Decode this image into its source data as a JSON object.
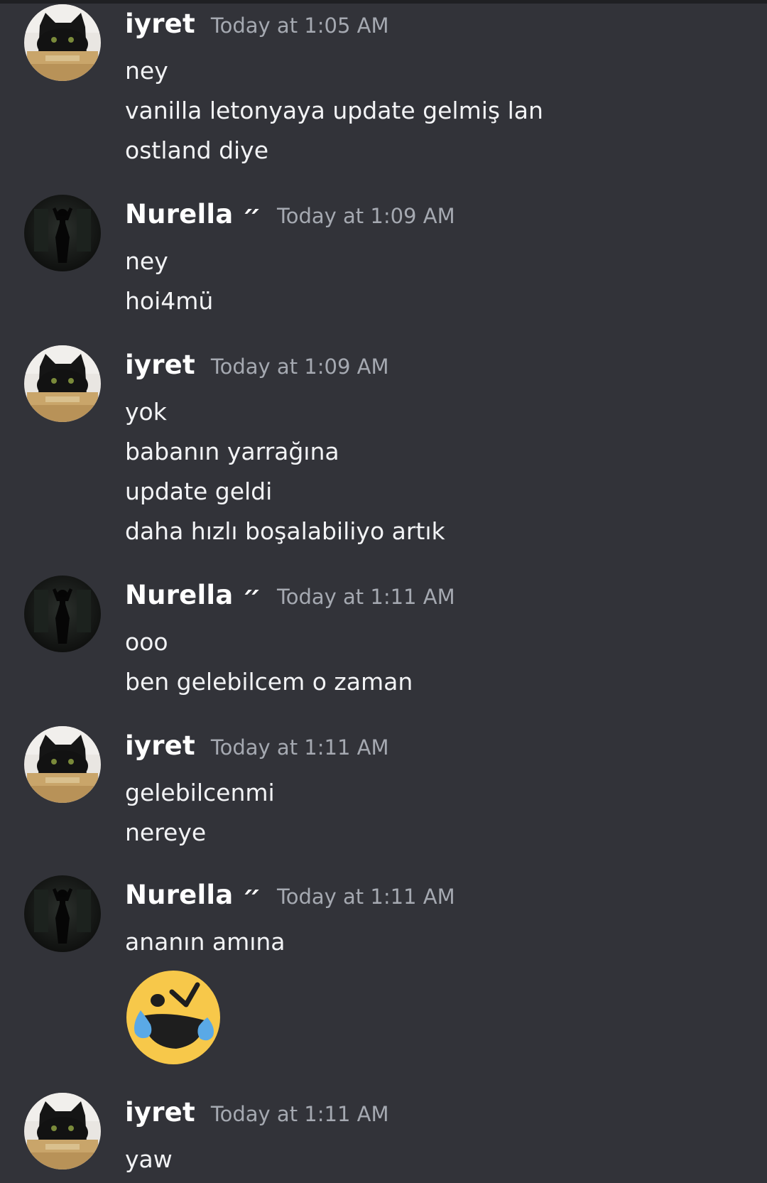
{
  "users": {
    "iyret": {
      "name": "iyret",
      "avatar": "cat-avatar"
    },
    "nurella": {
      "name": "Nurella ״",
      "avatar": "silhouette-avatar"
    }
  },
  "messages": [
    {
      "author": "iyret",
      "timestamp": "Today at 1:05 AM",
      "lines": [
        "ney",
        "vanilla letonyaya update gelmiş lan",
        "ostland diye"
      ]
    },
    {
      "author": "Nurella ״",
      "timestamp": "Today at 1:09 AM",
      "lines": [
        "ney",
        "hoi4mü"
      ]
    },
    {
      "author": "iyret",
      "timestamp": "Today at 1:09 AM",
      "lines": [
        "yok",
        "babanın yarrağına",
        "update geldi",
        "daha hızlı boşalabiliyo artık"
      ]
    },
    {
      "author": "Nurella ״",
      "timestamp": "Today at 1:11 AM",
      "lines": [
        "ooo",
        "ben gelebilcem o zaman"
      ]
    },
    {
      "author": "iyret",
      "timestamp": "Today at 1:11 AM",
      "lines": [
        "gelebilcenmi",
        "nereye"
      ]
    },
    {
      "author": "Nurella ״",
      "timestamp": "Today at 1:11 AM",
      "lines": [
        "ananın amına"
      ],
      "emoji": "loudly-crying-laughing-emoji"
    },
    {
      "author": "iyret",
      "timestamp": "Today at 1:11 AM",
      "lines": [
        "yaw"
      ]
    }
  ],
  "colors": {
    "background": "#323339",
    "username": "#ffffff",
    "timestamp": "#a5a9b1",
    "text": "#f2f3f5",
    "emoji_yellow": "#f7c84a",
    "emoji_tears": "#5aa9e6"
  }
}
